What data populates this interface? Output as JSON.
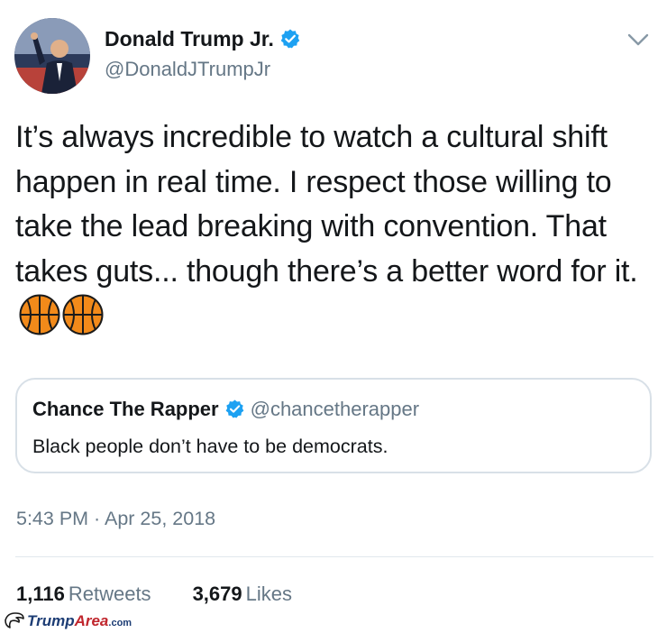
{
  "tweet": {
    "author": {
      "name": "Donald Trump Jr.",
      "handle": "@DonaldJTrumpJr",
      "verified": true,
      "avatar_icon": "profile-photo"
    },
    "text": "It’s always incredible to watch a cultural shift happen in real time. I respect those willing to take the lead breaking with convention. That takes guts... though there’s a better word for it.",
    "emojis": [
      "basketball",
      "basketball"
    ],
    "quoted_tweet": {
      "name": "Chance The Rapper",
      "handle": "@chancetherapper",
      "verified": true,
      "text": "Black people don’t have to be democrats."
    },
    "timestamp": "5:43 PM · Apr 25, 2018",
    "stats": {
      "retweets_count": "1,116",
      "retweets_label": "Retweets",
      "likes_count": "3,679",
      "likes_label": "Likes"
    }
  },
  "watermark": {
    "brand_part1": "Trump",
    "brand_part2": "Area",
    "brand_suffix": ".com"
  },
  "colors": {
    "text": "#14171a",
    "secondary_text": "#657786",
    "verified_blue": "#1da1f2",
    "border": "#d8e0e7",
    "basketball": "#f28a1a"
  }
}
